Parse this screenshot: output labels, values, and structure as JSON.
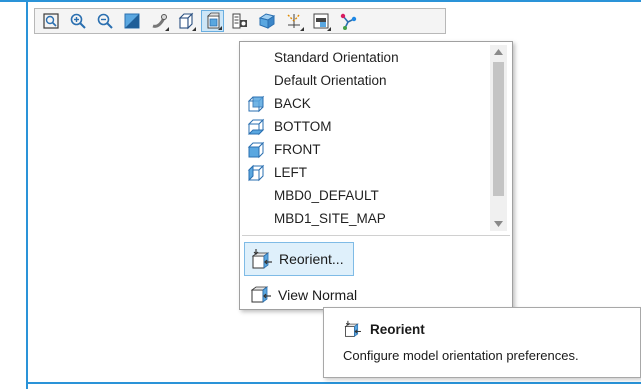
{
  "toolbar": {
    "buttons": [
      {
        "icon": "refit-icon"
      },
      {
        "icon": "zoom-in-icon"
      },
      {
        "icon": "zoom-out-icon"
      },
      {
        "icon": "repaint-icon"
      },
      {
        "icon": "display-style-icon"
      },
      {
        "icon": "view-box-icon"
      },
      {
        "icon": "saved-orientations-icon",
        "active": true
      },
      {
        "icon": "view-manager-icon"
      },
      {
        "icon": "perspective-icon"
      },
      {
        "icon": "datum-display-icon"
      },
      {
        "icon": "annotation-display-icon"
      },
      {
        "icon": "spin-center-icon"
      }
    ]
  },
  "menu": {
    "items": [
      {
        "label": "Standard Orientation",
        "icon": ""
      },
      {
        "label": "Default Orientation",
        "icon": ""
      },
      {
        "label": "BACK",
        "icon": "cube-back-icon"
      },
      {
        "label": "BOTTOM",
        "icon": "cube-bottom-icon"
      },
      {
        "label": "FRONT",
        "icon": "cube-front-icon"
      },
      {
        "label": "LEFT",
        "icon": "cube-left-icon"
      },
      {
        "label": "MBD0_DEFAULT",
        "icon": ""
      },
      {
        "label": "MBD1_SITE_MAP",
        "icon": ""
      }
    ],
    "reorient_label": "Reorient...",
    "view_normal_label": "View Normal"
  },
  "tooltip": {
    "title": "Reorient",
    "description": "Configure model orientation preferences."
  },
  "colors": {
    "accent": "#2a93d8",
    "highlight": "#dff0fb",
    "highlight_border": "#7fbbe6"
  }
}
